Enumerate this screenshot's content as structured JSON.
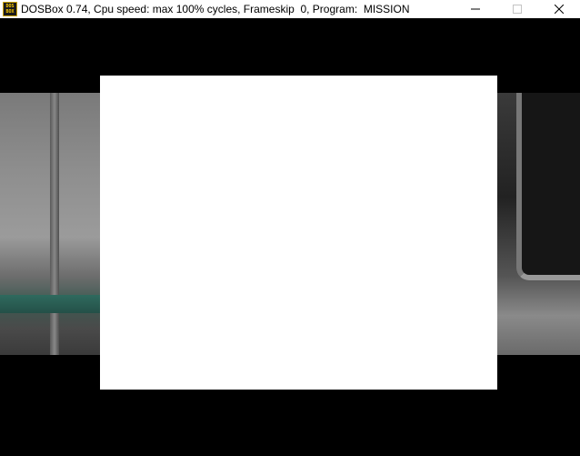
{
  "window": {
    "title": "DOSBox 0.74, Cpu speed: max 100% cycles, Frameskip  0, Program:  MISSION",
    "icon": {
      "name": "dosbox-icon",
      "text_top": "DOS",
      "text_bottom": "BOX"
    },
    "controls": {
      "minimize_icon": "minimize-icon",
      "maximize_icon": "maximize-icon",
      "close_icon": "close-icon"
    }
  },
  "colors": {
    "titlebar": "#ffffff",
    "screen_background": "#000000",
    "overlay": "#ffffff"
  }
}
